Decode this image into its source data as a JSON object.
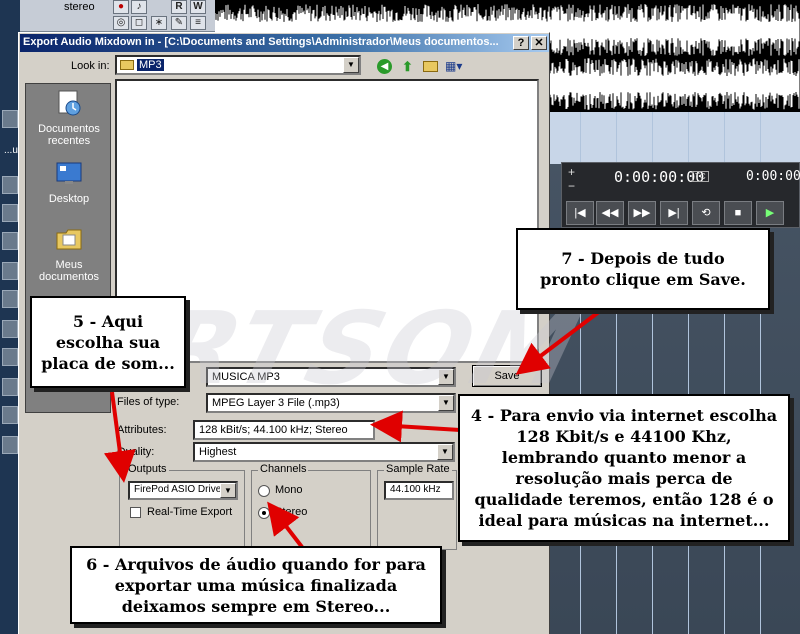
{
  "daw": {
    "track_name": "stereo",
    "track_buttons": [
      "R",
      "W"
    ],
    "time_main": "0:00:00:00",
    "time_badge": "TC",
    "time_secondary": "0:00:00:0",
    "sidebar_text": "...ut"
  },
  "dialog": {
    "title": "Export Audio Mixdown in - [C:\\Documents and Settings\\Administrador\\Meus documentos...",
    "help_button": "?",
    "close_button": "✕",
    "look_in_label": "Look in:",
    "look_in_value": "MP3",
    "places": [
      {
        "label": "Documentos recentes",
        "icon": "recent-documents-icon"
      },
      {
        "label": "Desktop",
        "icon": "desktop-icon"
      },
      {
        "label": "Meus documentos",
        "icon": "my-documents-icon"
      },
      {
        "label": "",
        "icon": "my-computer-icon"
      }
    ],
    "file_name_value": "MUSICA MP3",
    "files_of_type_label": "Files of type:",
    "files_of_type_value": "MPEG Layer 3 File (.mp3)",
    "attributes_label": "Attributes:",
    "attributes_value": "128 kBit/s; 44.100 kHz; Stereo",
    "quality_label": "Quality:",
    "quality_value": "Highest",
    "save_button": "Save",
    "outputs": {
      "title": "Outputs",
      "device_value": "FirePod ASIO Driver",
      "realtime_label": "Real-Time Export",
      "realtime_checked": false
    },
    "channels": {
      "title": "Channels",
      "mono_label": "Mono",
      "stereo_label": "Stereo",
      "selected": "Stereo"
    },
    "sample_rate": {
      "title": "Sample Rate",
      "value": "44.100 kHz"
    }
  },
  "annotations": {
    "step4": "4 - Para envio via internet escolha 128 Kbit/s e 44100 Khz, lembrando quanto menor a resolução mais perca de qualidade teremos, então 128 é o ideal para músicas na internet...",
    "step5": "5 - Aqui escolha sua placa de som...",
    "step6": "6 - Arquivos de áudio quando for para exportar uma música finalizada deixamos sempre em Stereo...",
    "step7": "7 - Depois de tudo pronto clique em Save.",
    "watermark": "ARTSOM"
  },
  "colors": {
    "title_bar": "#0a246a",
    "dialog_face": "#d4d0c8",
    "arrow": "#e00000",
    "waveform": "#ffffff"
  }
}
